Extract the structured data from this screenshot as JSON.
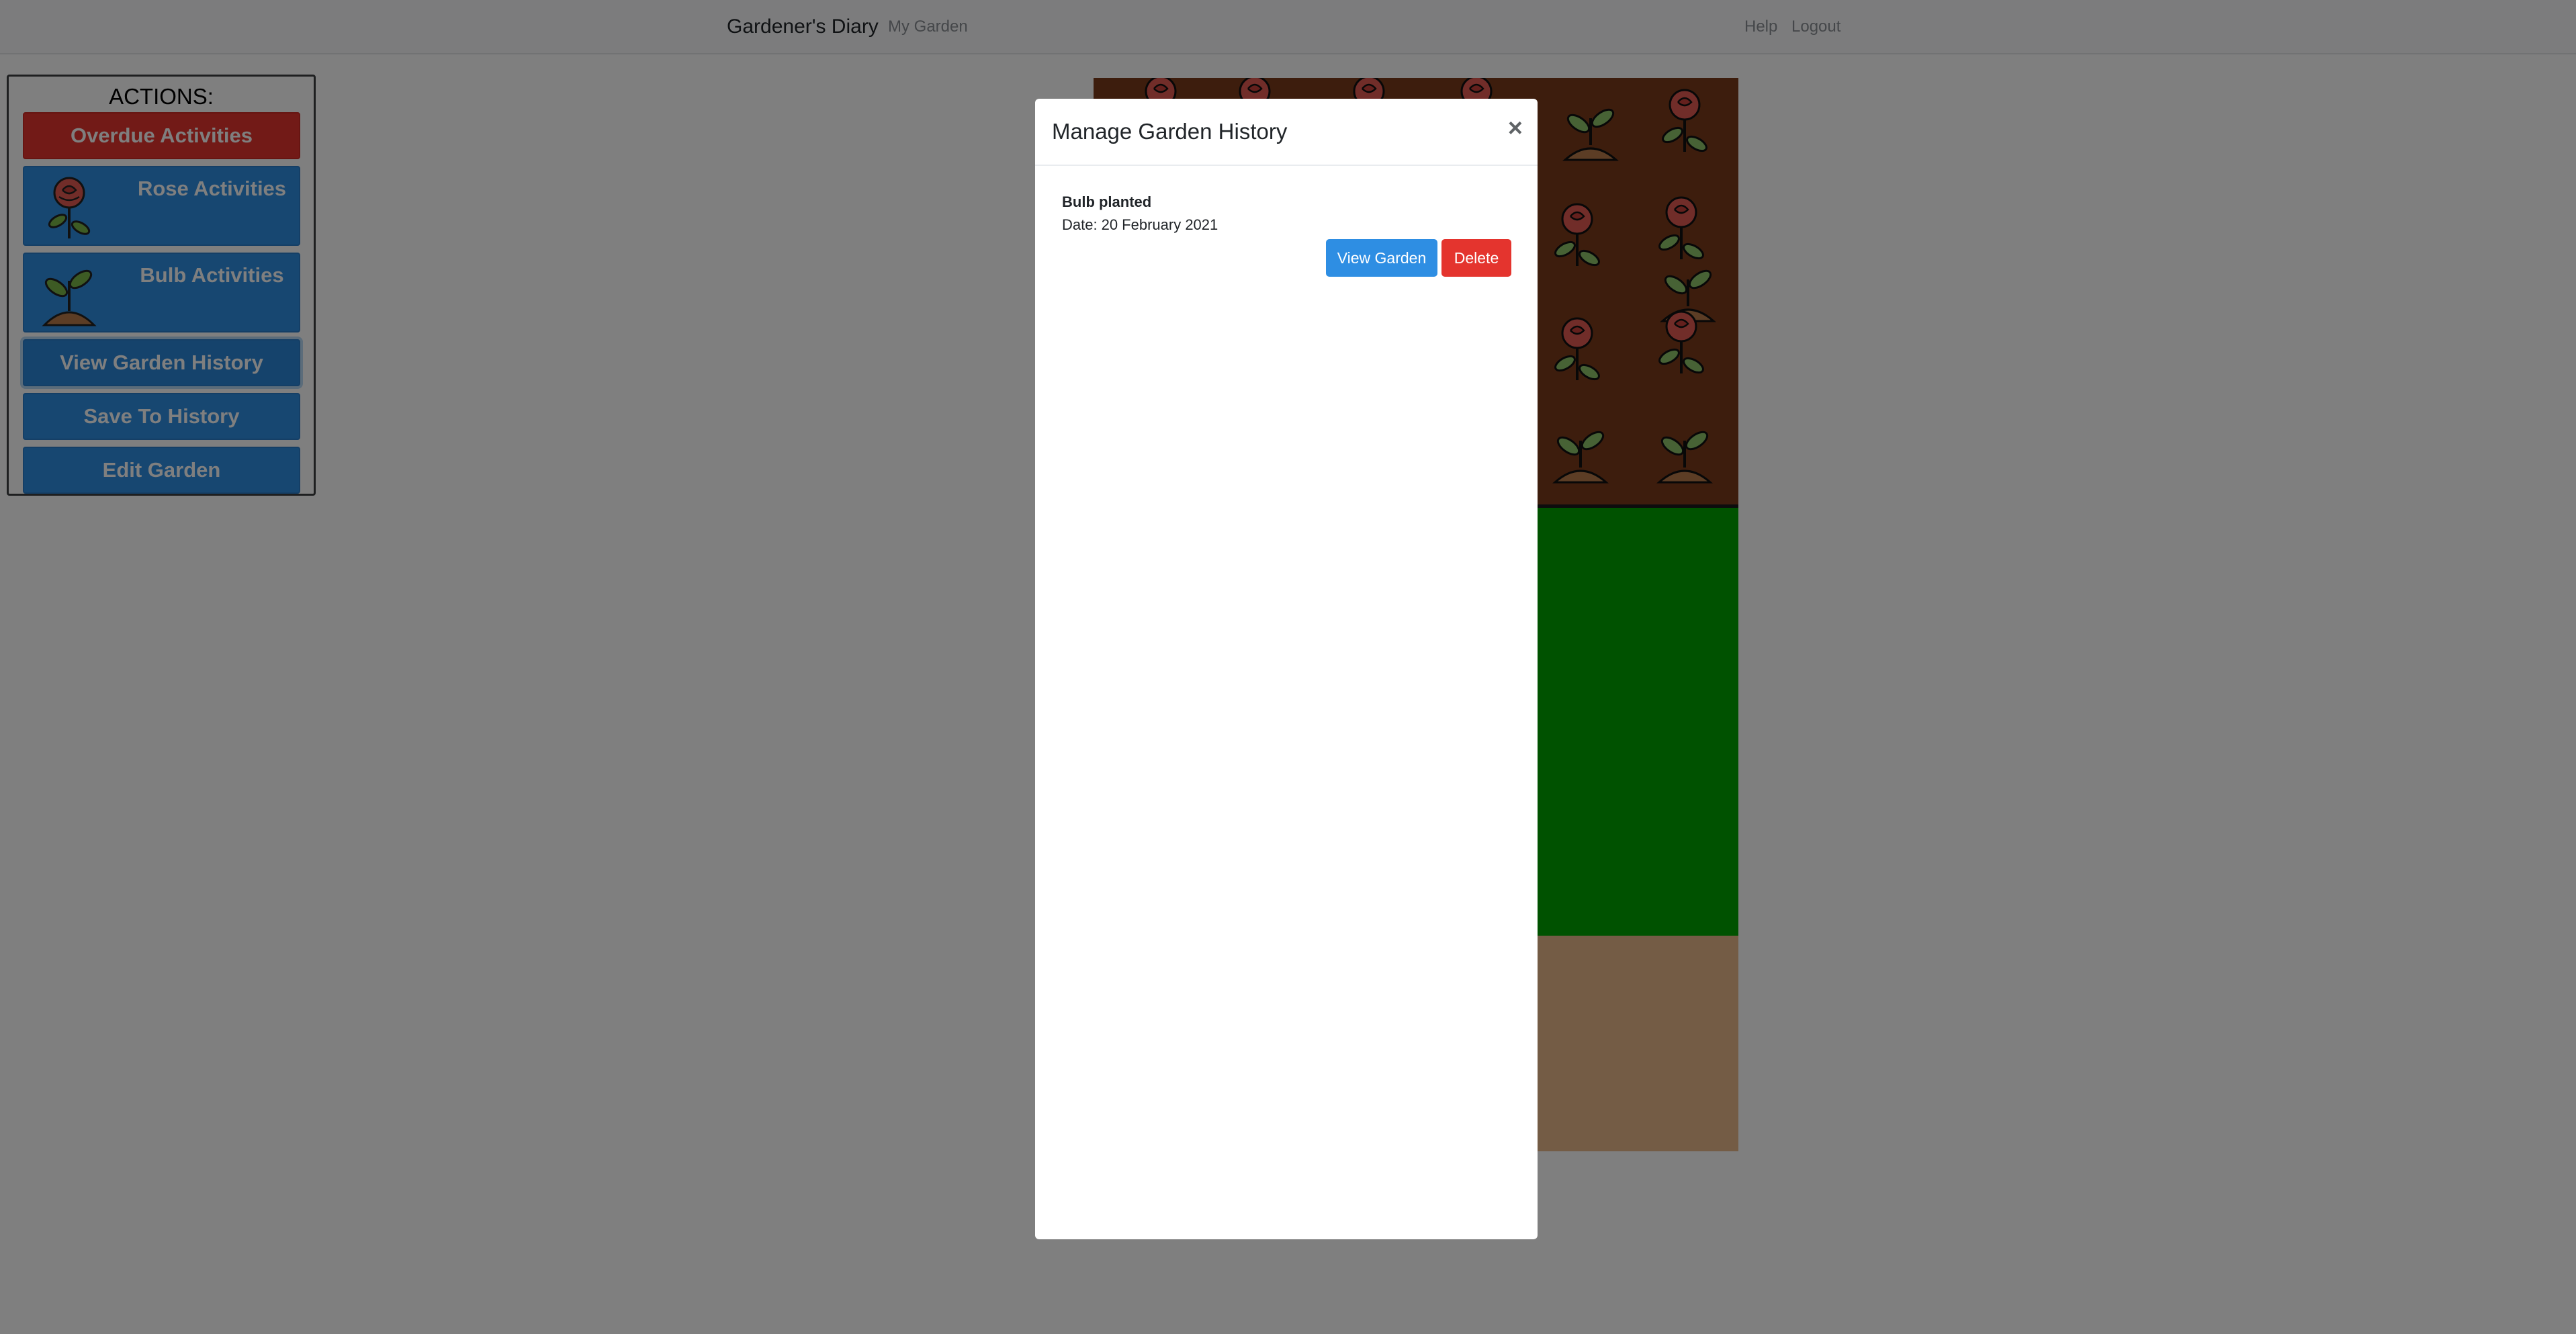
{
  "navbar": {
    "brand": "Gardener's Diary",
    "my_garden": "My Garden",
    "help": "Help",
    "logout": "Logout"
  },
  "actions": {
    "title": "ACTIONS:",
    "overdue": "Overdue Activities",
    "rose": "Rose Activities",
    "bulb": "Bulb Activities",
    "view_history": "View Garden History",
    "save_history": "Save To History",
    "edit_garden": "Edit Garden"
  },
  "modal": {
    "title": "Manage Garden History",
    "close": "×",
    "entries": [
      {
        "title": "Bulb planted",
        "date_label": "Date:",
        "date": "20 February 2021",
        "view_button": "View Garden",
        "delete_button": "Delete"
      }
    ]
  },
  "colors": {
    "primary": "#2e8ee3",
    "danger": "#e4342e",
    "soil": "#7a3b1b",
    "grass": "#00a400",
    "sand": "#e8b98a"
  },
  "icons": {
    "rose_button": "rose-icon",
    "bulb_button": "sprout-icon",
    "close": "close-icon"
  }
}
